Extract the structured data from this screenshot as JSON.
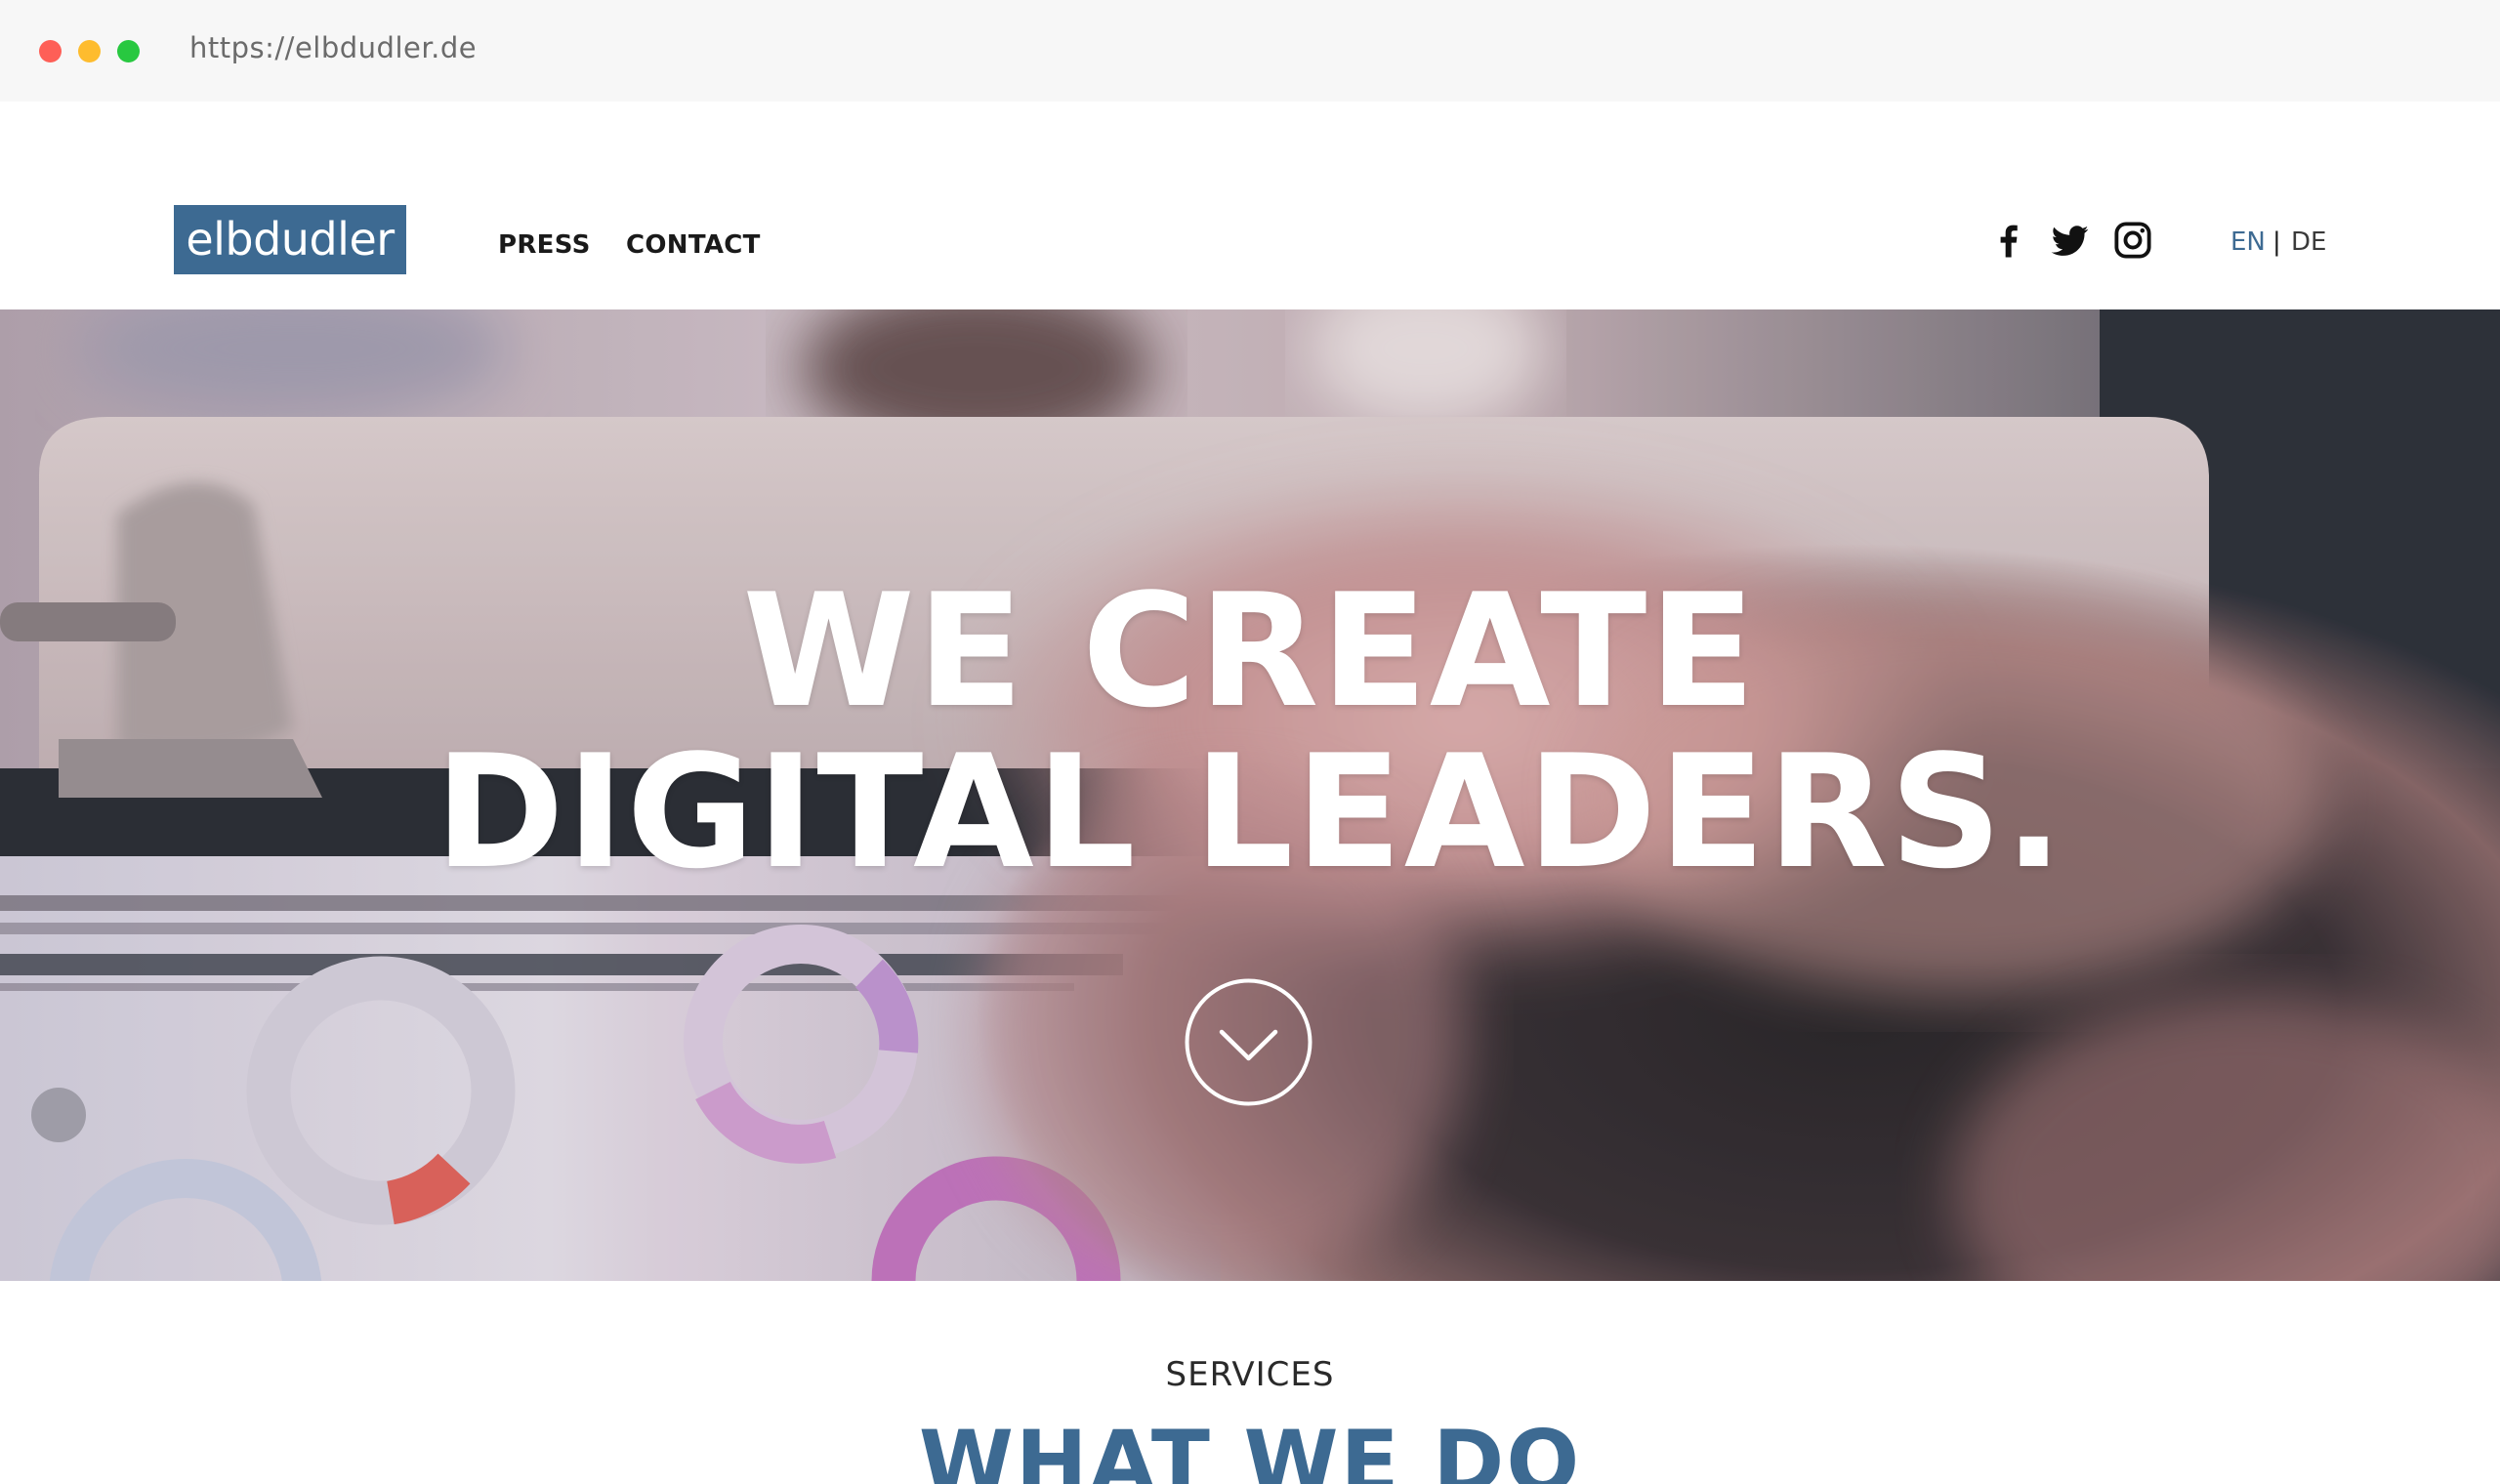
{
  "browser": {
    "url": "https://elbdudler.de"
  },
  "header": {
    "logo_text": "elbdudler",
    "nav": {
      "press": "PRESS",
      "contact": "CONTACT"
    },
    "social": [
      "facebook-icon",
      "twitter-icon",
      "instagram-icon"
    ],
    "lang": {
      "en": "EN",
      "separator": "|",
      "de": "DE"
    }
  },
  "hero": {
    "line1": "WE CREATE",
    "line2": "DIGITAL LEADERS."
  },
  "services": {
    "label": "SERVICES",
    "title": "WHAT WE DO"
  },
  "colors": {
    "brand_blue": "#3d6a92",
    "chrome_bg": "#f7f7f7"
  }
}
